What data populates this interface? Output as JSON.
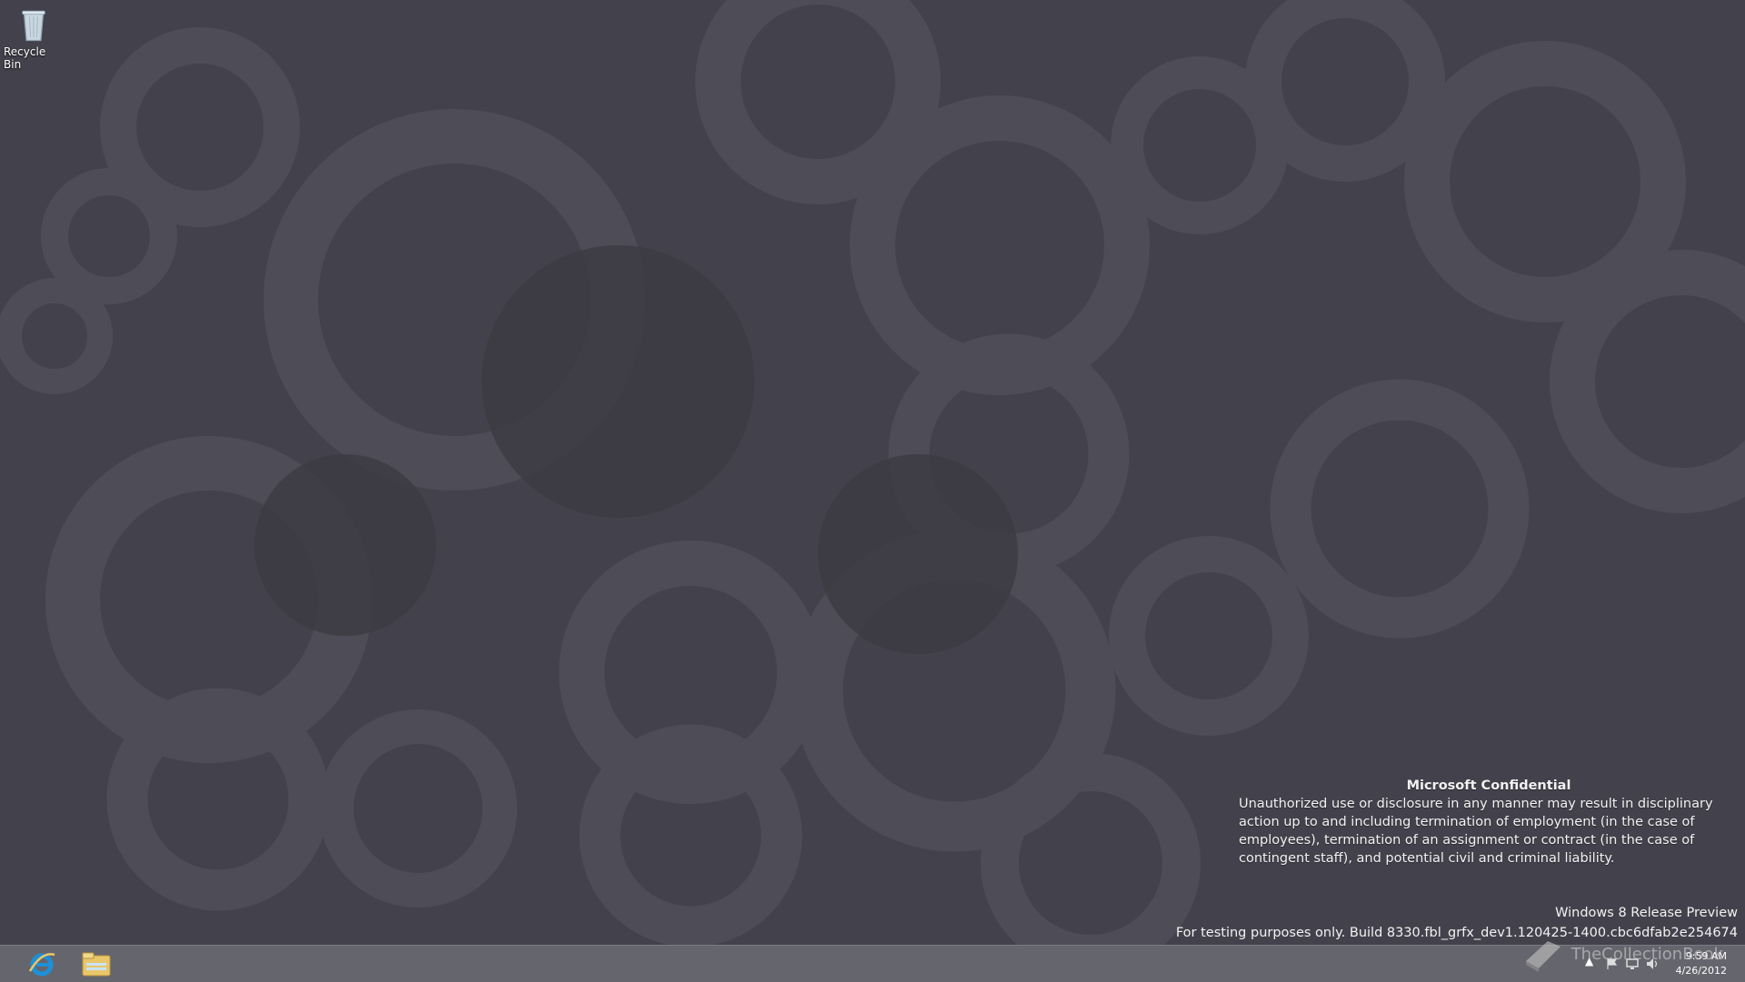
{
  "desktop": {
    "icons": [
      {
        "label": "Recycle Bin",
        "icon": "recycle-bin-icon"
      }
    ]
  },
  "notice": {
    "title": "Microsoft Confidential",
    "body": "Unauthorized use or disclosure in any manner may result in disciplinary action up to and including termination of employment (in the case of employees), termination of an assignment or contract (in the case of contingent staff), and potential civil and criminal liability."
  },
  "watermark": {
    "line1": "Windows 8 Release Preview",
    "line2": "For testing purposes only. Build 8330.fbl_grfx_dev1.120425-1400.cbc6dfab2e254674"
  },
  "taskbar": {
    "pinned": [
      {
        "name": "Internet Explorer",
        "icon": "internet-explorer-icon"
      },
      {
        "name": "File Explorer",
        "icon": "file-explorer-icon"
      }
    ],
    "clock": {
      "time": "9:59 AM",
      "date": "4/26/2012"
    }
  },
  "overlay": {
    "text": "TheCollectionBook"
  },
  "colors": {
    "background": "#43424c",
    "taskbar": "#686870",
    "ie_blue": "#1e90d6",
    "folder_yellow": "#e9c66a"
  }
}
